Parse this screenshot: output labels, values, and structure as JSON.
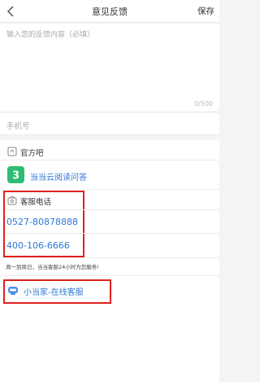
{
  "header": {
    "title": "意见反馈",
    "save_label": "保存"
  },
  "feedback": {
    "placeholder": "输入您的反馈内容（必填）",
    "counter": "0/500"
  },
  "phone": {
    "placeholder": "手机号"
  },
  "official": {
    "label": "官方吧",
    "qa_link": "当当云阅读问答"
  },
  "service": {
    "label": "客服电话",
    "phones": [
      "0527-80878888",
      "400-106-6666"
    ],
    "note": "周一到周日，当当客服24小时为您服务!",
    "online_label": "小当家-在线客服"
  },
  "colors": {
    "link": "#2f77d6",
    "accent_green": "#2ebd73",
    "highlight": "#e02020"
  }
}
